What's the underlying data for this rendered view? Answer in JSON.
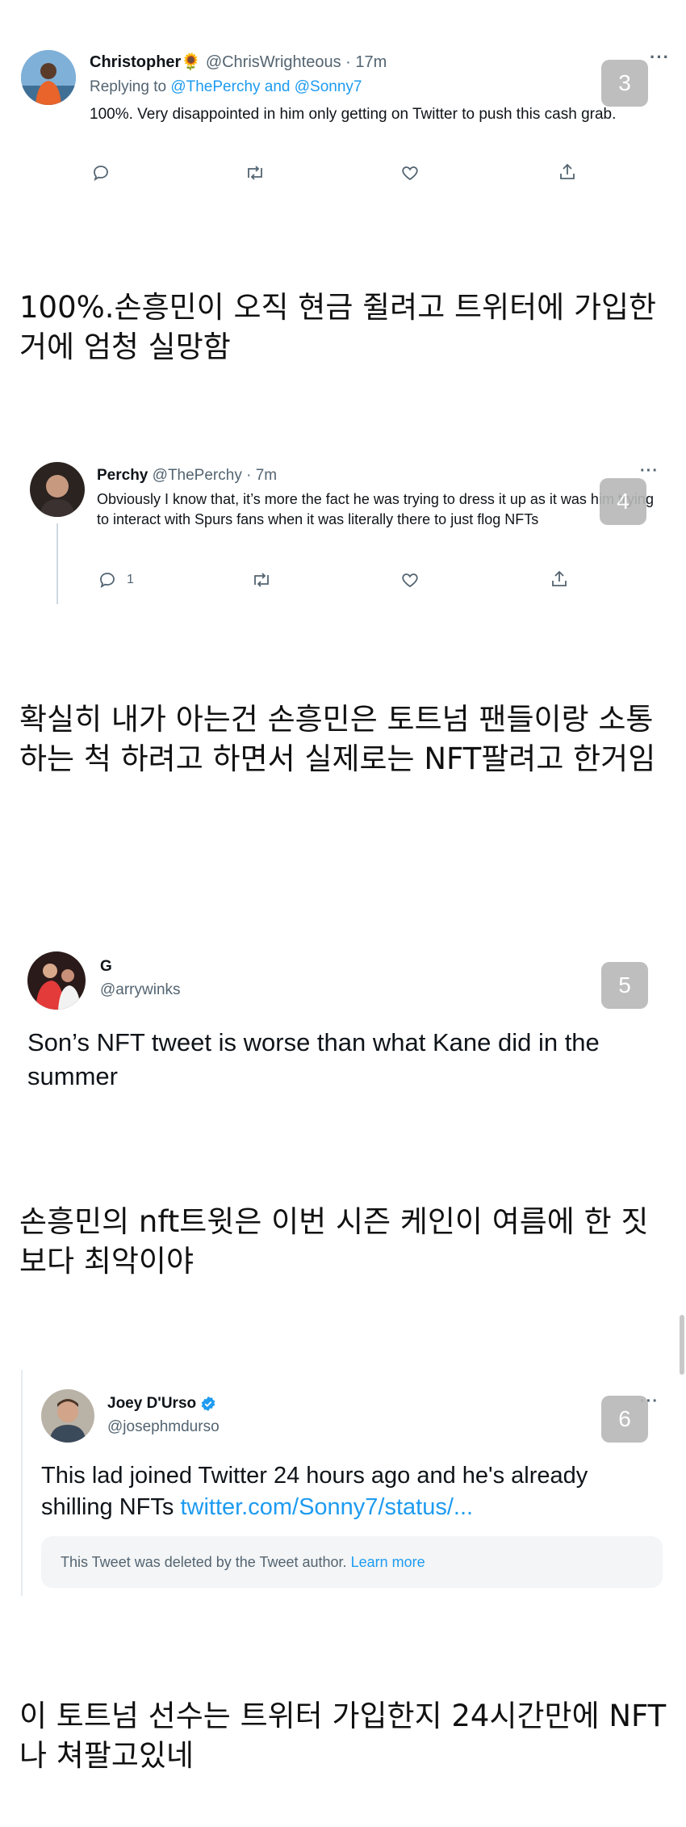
{
  "tweet3": {
    "name": "Christopher",
    "name_emoji": "🌻",
    "handle": "@ChrisWrighteous",
    "time": "· 17m",
    "replying_prefix": "Replying to ",
    "replying_users": "@ThePerchy and @Sonny7",
    "text": "100%. Very disappointed in him only getting on Twitter to push this cash grab.",
    "badge": "3",
    "more": "···",
    "icons": [
      "reply-icon",
      "retweet-icon",
      "like-icon",
      "share-icon"
    ]
  },
  "kor1": "100%.손흥민이 오직 현금 쥘려고 트위터에 가입한거에 엄청 실망함",
  "tweet4": {
    "name": "Perchy",
    "handle": "@ThePerchy",
    "time": "· 7m",
    "text": "Obviously I know that, it’s more the fact he was trying to dress it up as it was him trying to interact with Spurs fans when it was literally there to just flog NFTs",
    "reply_count": "1",
    "badge": "4",
    "more": "···"
  },
  "kor2": "확실히 내가 아는건 손흥민은 토트넘 팬들이랑 소통하는 척 하려고 하면서 실제로는 NFT팔려고 한거임",
  "tweet5": {
    "name": "G",
    "handle": "@arrywinks",
    "text": "Son’s NFT tweet is worse than what Kane did in the summer",
    "badge": "5"
  },
  "kor3": "손흥민의 nft트윗은 이번 시즌 케인이 여름에 한 짓보다 최악이야",
  "tweet6": {
    "name": "Joey D'Urso",
    "handle": "@josephmdurso",
    "text": "This lad joined Twitter 24 hours ago and he's already shilling NFTs ",
    "link": "twitter.com/Sonny7/status/...",
    "deleted_text": "This Tweet was deleted by the Tweet author. ",
    "learn_more": "Learn more",
    "badge": "6",
    "more": "···"
  },
  "kor4": "이 토트넘 선수는 트위터 가입한지 24시간만에 NFT나 쳐팔고있네",
  "colors": {
    "accent": "#1d9bf0",
    "text": "#0f1419",
    "muted": "#536471",
    "badge": "#b7b7b7"
  }
}
